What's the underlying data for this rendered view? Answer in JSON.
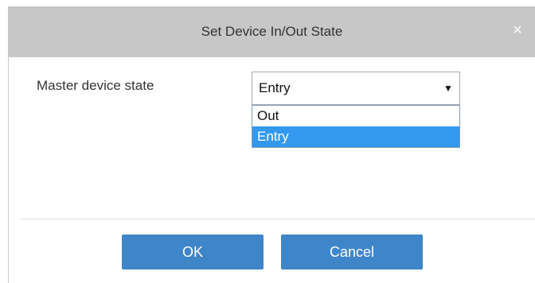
{
  "dialog": {
    "title": "Set Device In/Out State",
    "close_icon": "close-icon",
    "close_glyph": "×"
  },
  "form": {
    "master_state_label": "Master device state",
    "select": {
      "value": "Entry",
      "arrow_glyph": "▼",
      "options": [
        "Out",
        "Entry"
      ],
      "highlighted_option": "Entry"
    }
  },
  "buttons": {
    "ok_label": "OK",
    "cancel_label": "Cancel"
  },
  "colors": {
    "title_bar": "#c7c7c7",
    "button": "#3f86c8",
    "highlight": "#3399ee"
  }
}
